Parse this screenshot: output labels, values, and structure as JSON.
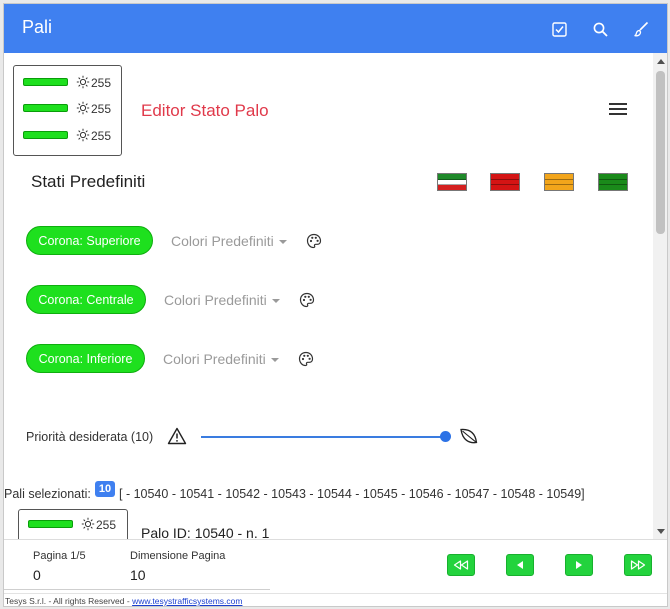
{
  "app": {
    "title": "Pali"
  },
  "toolbar": {
    "icons": [
      "checkbox-icon",
      "search-icon",
      "brush-icon"
    ]
  },
  "preview_pole": {
    "brightness": [
      "255",
      "255",
      "255"
    ]
  },
  "editor": {
    "title": "Editor Stato Palo"
  },
  "presets": {
    "label": "Stati Predefiniti",
    "flags": [
      {
        "name": "italian",
        "stripes": [
          "#1f8a2a",
          "#ffffff",
          "#d42020"
        ]
      },
      {
        "name": "red",
        "stripes": [
          "#d41414",
          "#d41414",
          "#d41414"
        ]
      },
      {
        "name": "orange",
        "stripes": [
          "#f2a51b",
          "#f2a51b",
          "#f2a51b"
        ]
      },
      {
        "name": "green",
        "stripes": [
          "#1a8a1a",
          "#1a8a1a",
          "#1a8a1a"
        ]
      }
    ]
  },
  "coronas": [
    {
      "label": "Corona: Superiore",
      "preset_label": "Colori Predefiniti",
      "color": "#1ee01e"
    },
    {
      "label": "Corona: Centrale",
      "preset_label": "Colori Predefiniti",
      "color": "#1ee01e"
    },
    {
      "label": "Corona: Inferiore",
      "preset_label": "Colori Predefiniti",
      "color": "#1ee01e"
    }
  ],
  "priority": {
    "label": "Priorità desiderata (10)",
    "value": 10,
    "slider_fraction": 1.0
  },
  "selection": {
    "label": "Pali selezionati:",
    "count": "10",
    "list": "[ - 10540 - 10541 - 10542 - 10543 - 10544 - 10545 - 10546 - 10547 - 10548 - 10549]"
  },
  "pole_item": {
    "brightness": "255",
    "title": "Palo ID: 10540 - n. 1"
  },
  "pagination": {
    "page_label": "Pagina 1/5",
    "page_value": "0",
    "size_label": "Dimensione Pagina",
    "size_value": "10"
  },
  "footer": {
    "copyright": "Tesys S.r.l. - All rights Reserved - ",
    "link": "www.tesystrafficsystems.com"
  },
  "colors": {
    "accent": "#3f80f0",
    "corona_green": "#1ee01e",
    "nav_green": "#23d33d",
    "editor_title": "#e0394a"
  }
}
